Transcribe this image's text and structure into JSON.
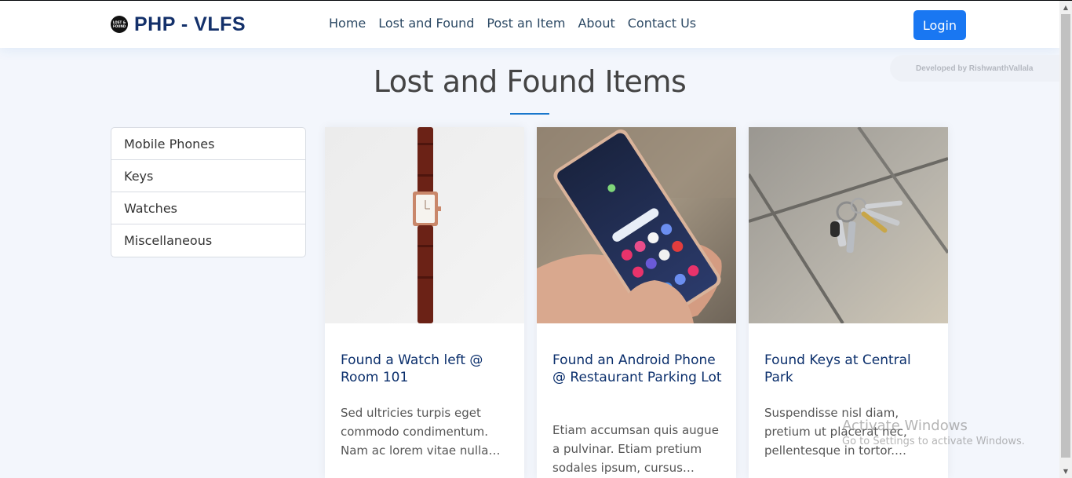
{
  "brand": {
    "logo_text": "PHP - VLFS",
    "badge_line1": "LOST &",
    "badge_line2": "FOUND"
  },
  "nav": [
    "Home",
    "Lost and Found",
    "Post an Item",
    "About",
    "Contact Us"
  ],
  "login_label": "Login",
  "dev_credit": "Developed by RishwanthVallala",
  "section_title": "Lost and Found Items",
  "categories": [
    "Mobile Phones",
    "Keys",
    "Watches",
    "Miscellaneous"
  ],
  "items": [
    {
      "title": "Found a Watch left @ Room 101",
      "text": "Sed ultricies turpis eget commodo condimentum. Nam ac lorem vitae nulla…"
    },
    {
      "title": "Found an Android Phone @ Restaurant Parking Lot",
      "text": "Etiam accumsan quis augue a pulvinar. Etiam pretium sodales ipsum, cursus…"
    },
    {
      "title": "Found Keys at Central Park",
      "text": "Suspendisse nisl diam, pretium ut placerat nec, pellentesque in tortor.…"
    }
  ],
  "os_watermark": {
    "line1": "Activate Windows",
    "line2": "Go to Settings to activate Windows."
  },
  "colors": {
    "brand": "#13306a",
    "accent": "#1977f2",
    "card_title": "#0b2f6c",
    "background": "#f3f6fc"
  }
}
